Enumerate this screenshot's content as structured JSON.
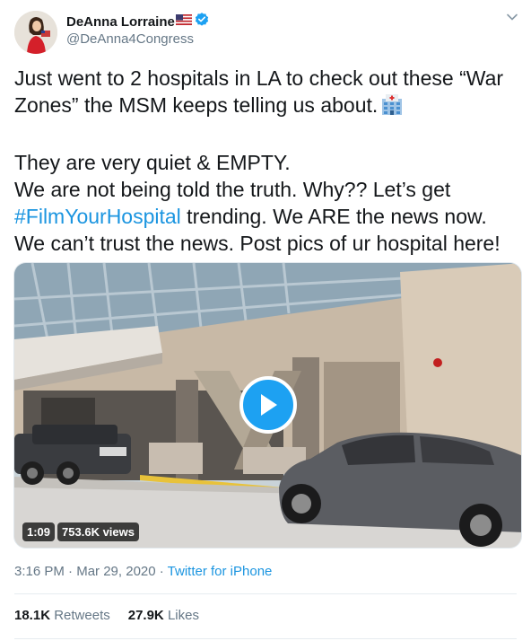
{
  "author": {
    "display_name": "DeAnna Lorraine",
    "handle": "@DeAnna4Congress",
    "verified": true
  },
  "tweet": {
    "line1": "Just went to 2 hospitals in LA to check out these “War Zones” the MSM keeps telling us about.",
    "line1_emoji": "hospital-icon",
    "p2_line1": "They are very quiet & EMPTY.",
    "p2_pre": "We are not being told the truth. Why?? Let’s get ",
    "hashtag": "#FilmYourHospital",
    "p2_post": " trending. We ARE the news now. We can’t trust the news. Post pics of ur hospital here!"
  },
  "media": {
    "duration": "1:09",
    "views": "753.6K views"
  },
  "meta": {
    "time": "3:16 PM",
    "sep": " · ",
    "date": "Mar 29, 2020",
    "source": "Twitter for iPhone"
  },
  "stats": {
    "retweets_count": "18.1K",
    "retweets_label": "Retweets",
    "likes_count": "27.9K",
    "likes_label": "Likes"
  },
  "colors": {
    "link": "#1b95e0",
    "play_button": "#1da1f2",
    "verified": "#1da1f2",
    "secondary_text": "#657786"
  }
}
